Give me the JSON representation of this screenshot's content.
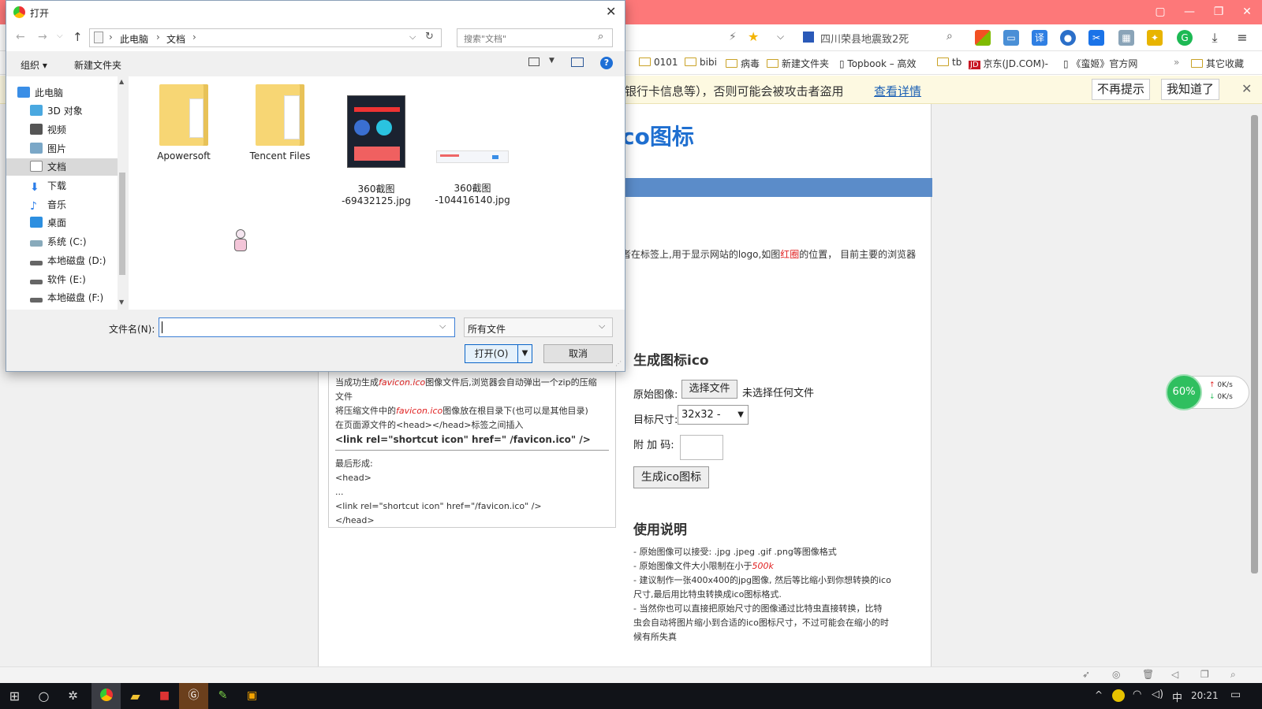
{
  "browser": {
    "tab_color": "#fd7879",
    "search_value": "四川荣县地震致2死",
    "bookmarks": [
      "0101",
      "bibi",
      "病毒",
      "新建文件夹",
      "Topbook – 高效",
      "tb",
      "京东(JD.COM)-",
      "《蛮姬》官方网",
      "其它收藏"
    ],
    "warning": {
      "text": "银行卡信息等），否则可能会被攻击者盗用",
      "link": "查看详情",
      "btn_dismiss": "不再提示",
      "btn_ok": "我知道了"
    }
  },
  "webpage": {
    "title": "co图标",
    "intro_text": "者在标签上,用于显示网站的logo,如图",
    "intro_red": "红圈",
    "intro_tail": "的位置， 目前主要的浏览器",
    "gen_heading": "生成图标ico",
    "label_orig": "原始图像:",
    "choose_file": "选择文件",
    "no_file": "未选择任何文件",
    "label_size": "目标尺寸:",
    "size_value": "32x32 -",
    "label_code": "附 加 码:",
    "gen_button": "生成ico图标",
    "usage_heading": "使用说明",
    "usage_lines": [
      "- 原始图像可以接受: .jpg .jpeg .gif .png等图像格式",
      "- 原始图像文件大小限制在小于",
      "- 建议制作一张400x400的jpg图像, 然后等比缩小到你想转换的ico",
      "尺寸,最后用比特虫转换成ico图标格式.",
      "- 当然你也可以直接把原始尺寸的图像通过比特虫直接转换，比特",
      "虫会自动将图片缩小到合适的ico图标尺寸，不过可能会在缩小的时",
      "候有所失真"
    ],
    "usage_red": "500k",
    "left_lines": {
      "l1a": "当成功生成",
      "l1b": "favicon.ico",
      "l1c": "图像文件后,浏览器会自动弹出一个zip的压缩",
      "l2": "文件",
      "l3a": "将压缩文件中的",
      "l3b": "favicon.ico",
      "l3c": "图像放在根目录下(也可以是其他目录)",
      "l4": "在页面源文件的<head></head>标签之间插入",
      "l5": "<link rel=\"shortcut icon\" href=\" /favicon.ico\" />",
      "l6": "最后形成:",
      "l7": "<head>",
      "l8": "...",
      "l9": "<link rel=\"shortcut icon\" href=\"/favicon.ico\" />",
      "l10": "</head>"
    }
  },
  "speed_widget": {
    "percent": "60%",
    "up": "0K/s",
    "down": "0K/s"
  },
  "taskbar": {
    "time": "20:21",
    "ime": "中"
  },
  "dialog": {
    "title": "打开",
    "breadcrumb": [
      "此电脑",
      "文档"
    ],
    "search_placeholder": "搜索\"文档\"",
    "toolbar": {
      "organize": "组织 ▾",
      "new_folder": "新建文件夹"
    },
    "nav": [
      "此电脑",
      "3D 对象",
      "视频",
      "图片",
      "文档",
      "下载",
      "音乐",
      "桌面",
      "系统 (C:)",
      "本地磁盘 (D:)",
      "软件 (E:)",
      "本地磁盘 (F:)"
    ],
    "files": [
      {
        "name": "Apowersoft",
        "type": "folder"
      },
      {
        "name": "Tencent Files",
        "type": "folder"
      },
      {
        "name": "360截图\n-69432125.jpg",
        "type": "image"
      },
      {
        "name": "360截图\n-104416140.jpg",
        "type": "image"
      }
    ],
    "filename_label": "文件名(N):",
    "filename_value": "",
    "filetype_value": "所有文件",
    "open_button": "打开(O)",
    "cancel_button": "取消"
  }
}
